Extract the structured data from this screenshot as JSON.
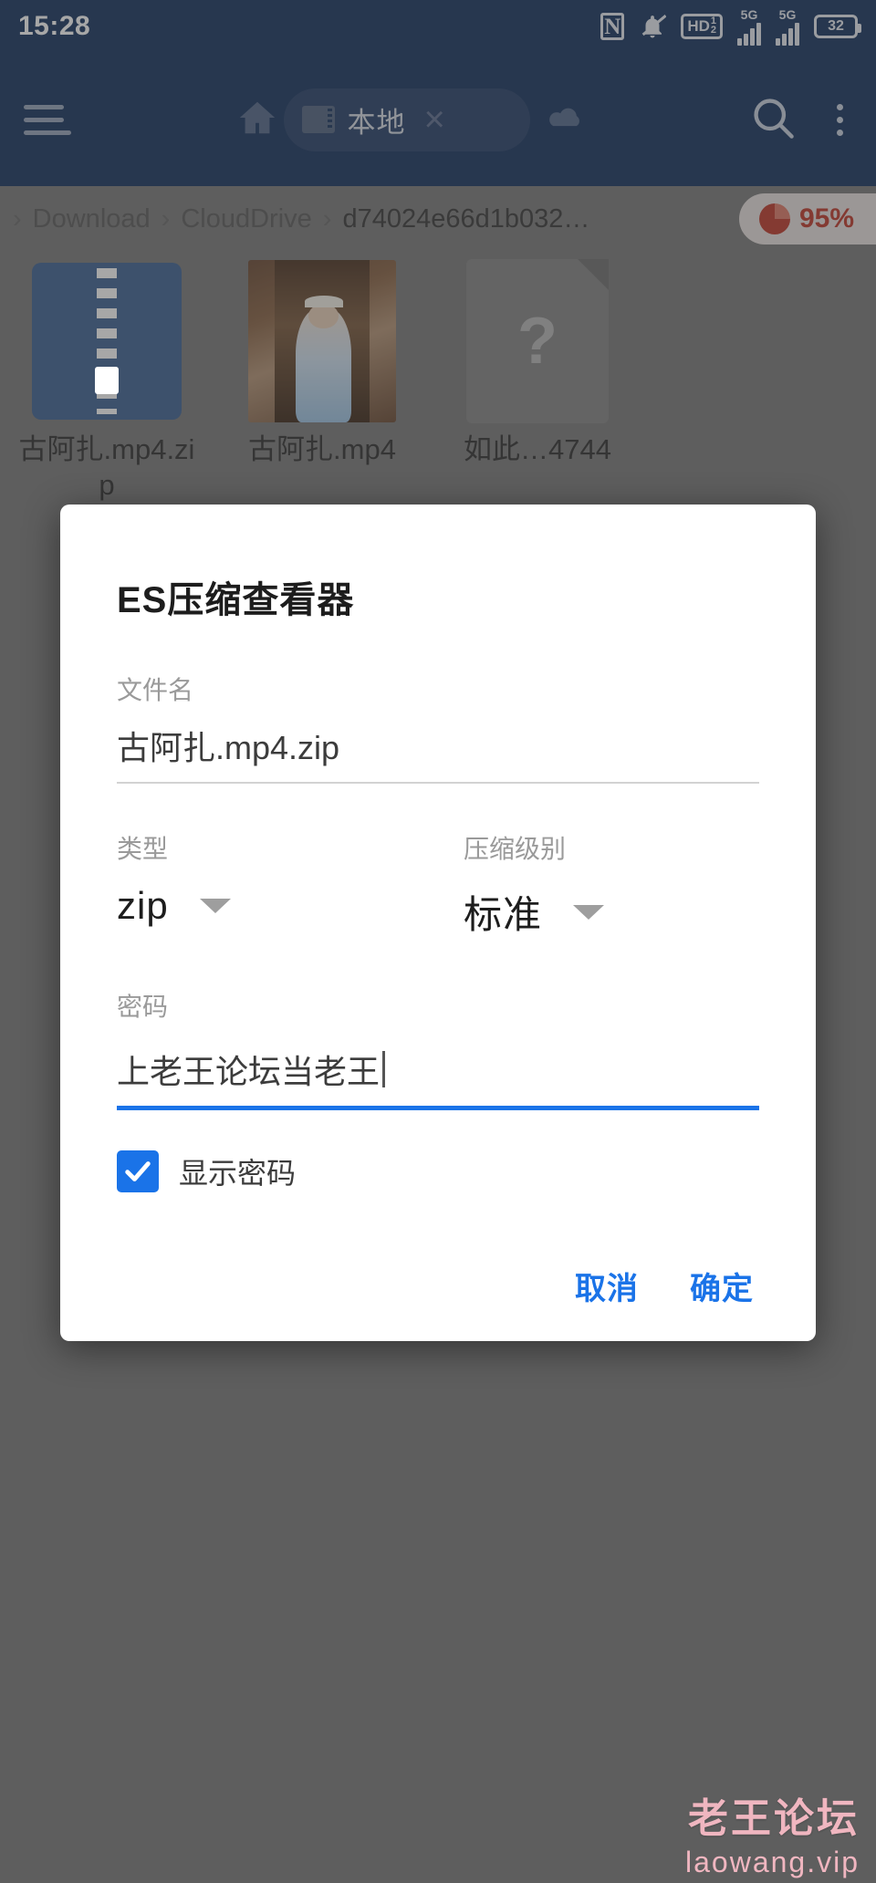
{
  "statusbar": {
    "time": "15:28",
    "icons": [
      "nfc-icon",
      "notifications-muted-icon",
      "hd-voice-icon",
      "signal-5g-icon",
      "signal-5g-secondary-icon"
    ],
    "nfc_label": "N",
    "hd_label": "HD",
    "hd_fraction_top": "1",
    "hd_fraction_bottom": "2",
    "network_1": "5G",
    "network_2": "5G",
    "battery_level": "32"
  },
  "toolbar": {
    "menu_icon": "hamburger-menu-icon",
    "home_icon": "home-icon",
    "tab": {
      "label": "本地",
      "icon": "storage-card-icon",
      "close": "×"
    },
    "cloud_icon": "cloud-icon",
    "search_icon": "search-icon",
    "overflow_icon": "kebab-menu-icon"
  },
  "breadcrumb": {
    "leading_sep": "›",
    "items": [
      "Download",
      "CloudDrive",
      "d74024e66d1b032…"
    ],
    "separator": "›",
    "storage_badge": {
      "text": "95%",
      "icon": "pie-chart-icon",
      "color": "#c0392b"
    }
  },
  "files": [
    {
      "name": "古阿扎.mp4.zip",
      "icon": "zip-archive-icon"
    },
    {
      "name": "古阿扎.mp4",
      "icon": "video-thumbnail-icon"
    },
    {
      "name": "如此…4744",
      "icon": "unknown-file-icon",
      "glyph": "?"
    }
  ],
  "dialog": {
    "title": "ES压缩查看器",
    "filename": {
      "label": "文件名",
      "value": "古阿扎.mp4.zip"
    },
    "type": {
      "label": "类型",
      "value": "zip",
      "caret": "dropdown-caret-icon"
    },
    "level": {
      "label": "压缩级别",
      "value": "标准",
      "caret": "dropdown-caret-icon"
    },
    "password": {
      "label": "密码",
      "value": "上老王论坛当老王",
      "focused": true,
      "accent": "#1a73e8"
    },
    "show_password": {
      "label": "显示密码",
      "checked": true
    },
    "cancel_label": "取消",
    "confirm_label": "确定"
  },
  "watermark": {
    "line1": "老王论坛",
    "line2": "laowang.vip",
    "color": "#f0b6c0"
  }
}
